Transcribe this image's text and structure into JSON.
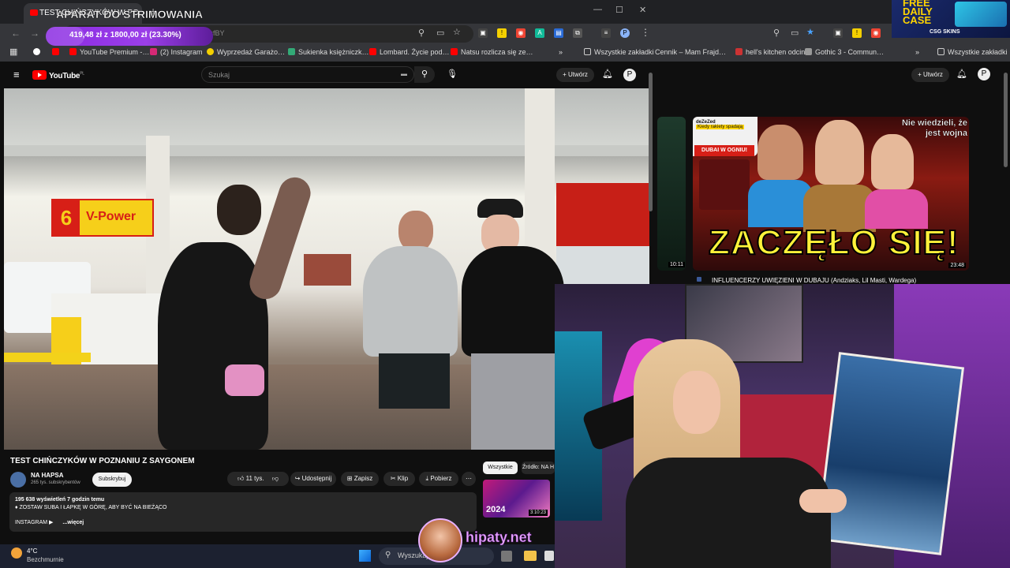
{
  "overlay": {
    "title": "APARAT DO STRIMOWANIA",
    "goal_text": "419,48 zł z 1800,00 zł (23.30%)",
    "goal_progress": 0.233,
    "watermark": "hipaty.net",
    "free_case": {
      "line1": "FREE",
      "line2": "DAILY",
      "line3": "CASE",
      "brand": "CSG SKINS"
    }
  },
  "browser": {
    "tab_title": "TEST CHIŃCZYKÓW W PO…",
    "omnibox_url": "…rthAggsfBY",
    "bookmarks": [
      "YouTube Premium -…",
      "(2) Instagram",
      "Wyprzedaż Garażo…",
      "Sukienka księżniczk…",
      "Lombard. Życie pod…",
      "Natsu rozlicza się ze…"
    ],
    "all_bookmarks": "Wszystkie zakładki",
    "right_bookmarks": [
      "Cennik – Mam Frajd…",
      "hell's kitchen odcin…",
      "Gothic 3 - Commun…"
    ]
  },
  "youtube": {
    "logo": "YouTube",
    "logo_region": "PL",
    "search_placeholder": "Szukaj",
    "create_label": "Utwórz",
    "video_title": "TEST CHIŃCZYKÓW W POZNANIU Z SAYGONEM",
    "channel_name": "NA HAPSA",
    "channel_subs": "265 tys. subskrybentów",
    "subscribe_label": "Subskrybuj",
    "likes": "11 tys.",
    "share": "Udostępnij",
    "save": "Zapisz",
    "clip": "Klip",
    "download": "Pobierz",
    "views_line": "195 638 wyświetleń  7 godzin temu",
    "desc_line": "♦ ZOSTAW SUBA I ŁAPKĘ W GÓRĘ, ABY BYĆ NA BIEŻĄCO",
    "desc_more_left": "INSTAGRAM ▶",
    "desc_more": "...więcej",
    "chips": [
      "Wszystkie",
      "Źródło: NA H"
    ],
    "side_thumb_label": "2024",
    "side_thumb_duration": "3:10:23",
    "shell_sign": {
      "num": "6",
      "text": "V-Power"
    }
  },
  "right_panel": {
    "create_label": "Utwórz",
    "thumb_big_text": "ZACZĘŁO SIĘ!",
    "thumb_corner_text": "Nie wiedzieli, że jest wojna",
    "thumb_duration": "23:48",
    "thumb_prev_duration": "10:11",
    "dubai_label": "DUBAI W OGNIU!",
    "tweet_name": "deZeZed",
    "tweet_handle": "Kiedy rakiety spadają",
    "video_title": "INFLUENCERZY UWIĘZIENI W DUBAJU (Andziaks, Lil Masti, Wardega)"
  },
  "taskbar": {
    "weather_temp": "4°C",
    "weather_desc": "Bezchmurnie",
    "search_placeholder": "Wyszukaj"
  },
  "colors": {
    "accent_purple": "#9b3fe8",
    "yt_red": "#ff0000",
    "shell_yellow": "#f6cf1a",
    "shell_red": "#d71f17",
    "thumb_yellow": "#fff23a"
  }
}
